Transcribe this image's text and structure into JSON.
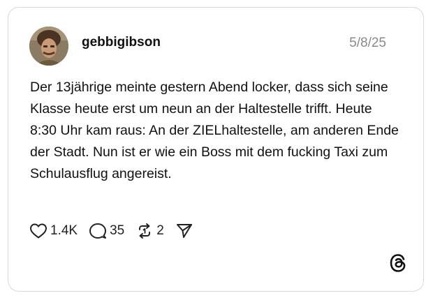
{
  "post": {
    "username": "gebbigibson",
    "date": "5/8/25",
    "text": "Der 13jährige meinte gestern Abend locker, dass sich seine Klasse heute erst um neun an der Haltestelle trifft. Heute 8:30 Uhr kam raus: An der ZIELhaltestelle, am anderen Ende der Stadt. Nun ist er wie ein Boss mit dem fucking Taxi zum Schulausflug angereist.",
    "likes": "1.4K",
    "replies": "35",
    "reposts": "2"
  },
  "icons": {
    "like": "heart-icon",
    "reply": "speech-bubble-icon",
    "repost": "repost-icon",
    "share": "send-icon",
    "brand": "threads-logo-icon"
  }
}
